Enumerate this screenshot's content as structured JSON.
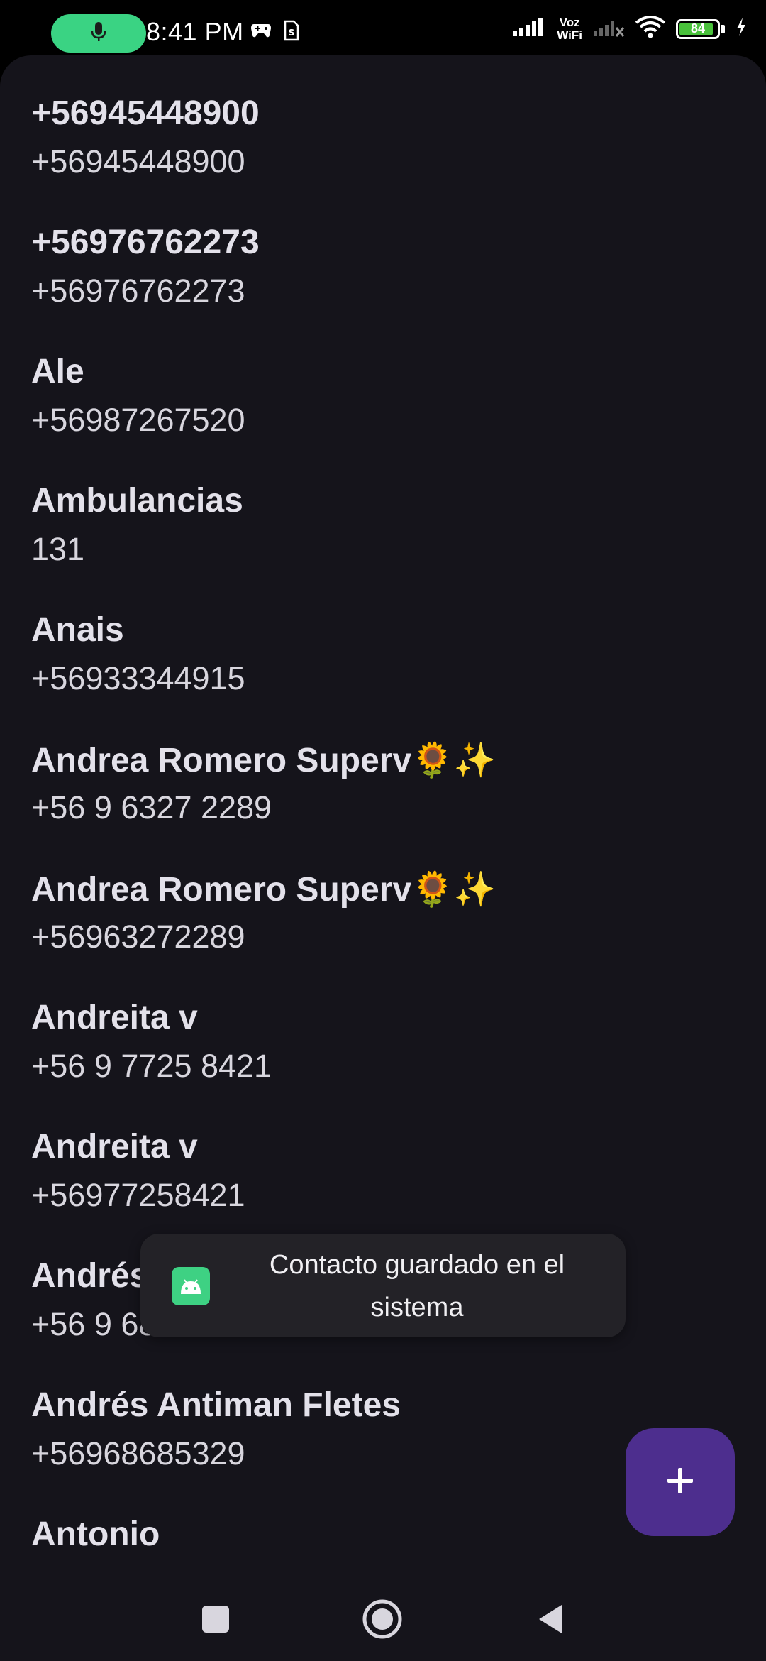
{
  "status_bar": {
    "time": "8:41 PM",
    "voz_label": "Voz",
    "wifi_label": "WiFi",
    "battery_level": "84",
    "icons": [
      "mic-icon",
      "gamepad-icon",
      "sim-icon",
      "signal-icon",
      "no-signal-icon",
      "wifi-icon",
      "battery-icon",
      "charging-icon"
    ]
  },
  "contacts": [
    {
      "name": "+56945448900",
      "number": "+56945448900"
    },
    {
      "name": "+56976762273",
      "number": "+56976762273"
    },
    {
      "name": "Ale",
      "number": "+56987267520"
    },
    {
      "name": "Ambulancias",
      "number": "131"
    },
    {
      "name": "Anais",
      "number": "+56933344915"
    },
    {
      "name": "Andrea Romero Superv🌻✨",
      "number": "+56 9 6327 2289"
    },
    {
      "name": "Andrea Romero Superv🌻✨",
      "number": "+56963272289"
    },
    {
      "name": "Andreita v",
      "number": "+56 9 7725 8421"
    },
    {
      "name": "Andreita v",
      "number": "+56977258421"
    },
    {
      "name": "Andrés Antiman Fletes",
      "number": "+56 9 6868 5329"
    },
    {
      "name": "Andrés Antiman Fletes",
      "number": "+56968685329"
    },
    {
      "name": "Antonio",
      "number": ""
    }
  ],
  "toast": {
    "message": "Contacto guardado en el sistema",
    "icon": "android-icon"
  },
  "fab": {
    "icon": "plus-icon",
    "color": "#4d2e8e"
  },
  "nav_bar": {
    "icons": [
      "recents-square-icon",
      "home-circle-icon",
      "back-triangle-icon"
    ]
  },
  "colors": {
    "background": "#15141b",
    "text_primary": "#e3e1ea",
    "toast_bg": "#232227",
    "mic_pill": "#3ad383",
    "battery_fill": "#49c13b"
  }
}
